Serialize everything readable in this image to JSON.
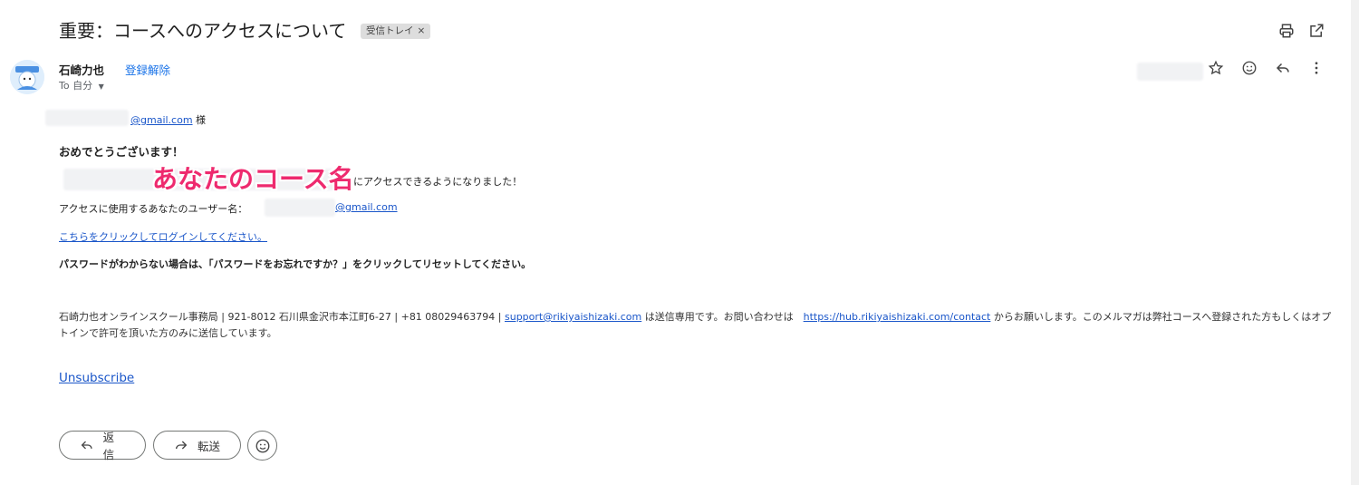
{
  "header": {
    "subject": "重要：コースへのアクセスについて",
    "label_chip": "受信トレイ",
    "label_chip_close": "×",
    "print_icon": "print-icon",
    "open_new_window_icon": "open-in-new-icon"
  },
  "message": {
    "sender_name": "石崎力也",
    "unsubscribe_link": "登録解除",
    "to_label": "To 自分",
    "to_dropdown_icon": "caret-down-icon",
    "star_icon": "star-icon",
    "emoji_icon": "emoji-icon",
    "reply_icon": "reply-icon",
    "more_icon": "more-vert-icon"
  },
  "body": {
    "greeting_email": "@gmail.com",
    "greeting_suffix": " 様",
    "congrats": "おめでとうございます！",
    "course_name_overlay": "あなたのコース名",
    "access_text": "にアクセスできるようになりました！",
    "username_label": "アクセスに使用するあなたのユーザー名：",
    "username_email": "@gmail.com",
    "login_link": "こちらをクリックしてログインしてください。",
    "password_note": "パスワードがわからない場合は、「パスワードをお忘れですか？」をクリックしてリセットしてください。",
    "footer_part1": "石崎力也オンラインスクール事務局 | 921-8012 石川県金沢市本江町6-27 | +81 08029463794 | ",
    "footer_support_email": "support@rikiyaishizaki.com",
    "footer_part2": " は送信専用です。お問い合わせは　",
    "footer_contact_link": "https://hub.rikiyaishizaki.com/contact",
    "footer_part3": " からお願いします。このメルマガは弊社コースへ登録された方もしくはオプトインで許可を頂いた方のみに送信しています。",
    "unsubscribe_footer": "Unsubscribe"
  },
  "actions": {
    "reply_label": "返信",
    "forward_label": "転送"
  },
  "colors": {
    "link": "#1a56c9",
    "overlay_text": "#ee2a6e",
    "chip_bg": "#dddddd"
  }
}
